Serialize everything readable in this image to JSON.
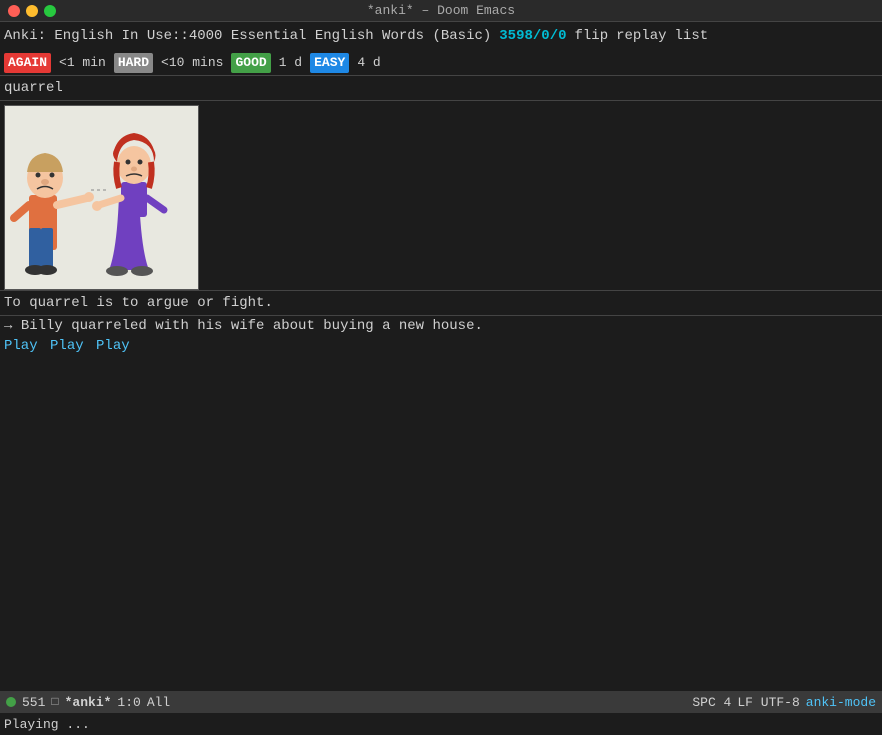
{
  "titlebar": {
    "title": "*anki* – Doom Emacs"
  },
  "header": {
    "prefix": "Anki: English In Use::4000 Essential English Words (Basic)",
    "stats": "3598/0/0",
    "flip": "flip",
    "replay": "replay",
    "list": "list"
  },
  "ratings": {
    "again_label": "AGAIN",
    "again_time": "<1 min",
    "hard_label": "HARD",
    "hard_time": "<10 mins",
    "good_label": "GOOD",
    "good_time": "1 d",
    "easy_label": "EASY",
    "easy_time": "4 d"
  },
  "card": {
    "word": "quarrel",
    "definition": "To quarrel is to argue or fight.",
    "example_arrow": "→",
    "example": "Billy quarreled with his wife about buying a new house."
  },
  "play_links": [
    "Play",
    "Play",
    "Play"
  ],
  "modeline": {
    "buffer_num": "551",
    "filename": "*anki*",
    "position": "1:0",
    "all_label": "All",
    "col_info": "SPC 4",
    "encoding": "LF UTF-8",
    "mode": "anki-mode"
  },
  "echo_area": {
    "text": "Playing ..."
  },
  "icons": {
    "close": "●",
    "minimize": "●",
    "maximize": "●"
  }
}
